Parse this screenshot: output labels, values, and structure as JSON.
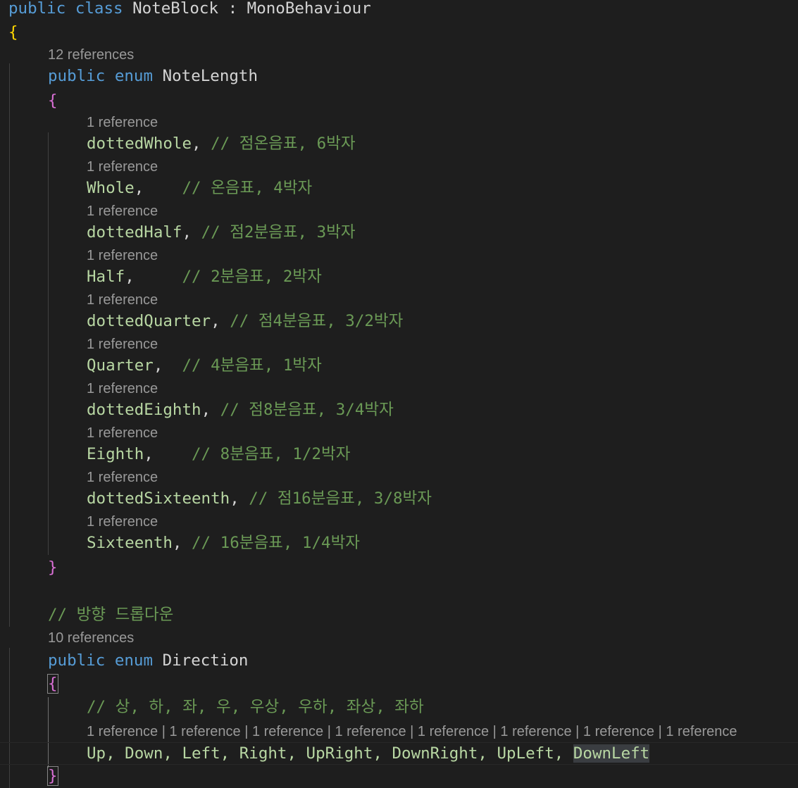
{
  "code": {
    "class_decl": {
      "kw_public": "public",
      "kw_class": "class",
      "class_name": "NoteBlock",
      "colon": ":",
      "base": "MonoBehaviour"
    },
    "open_brace": "{",
    "close_brace": "}",
    "lens_12": "12 references",
    "lens_10": "10 references",
    "lens_1": "1 reference",
    "lens_8x": "1 reference | 1 reference | 1 reference | 1 reference | 1 reference | 1 reference | 1 reference | 1 reference",
    "enum1": {
      "kw_public": "public",
      "kw_enum": "enum",
      "name": "NoteLength",
      "members": [
        {
          "name": "dottedWhole",
          "sep": ",",
          "pad": " ",
          "comment": "// 점온음표, 6박자"
        },
        {
          "name": "Whole",
          "sep": ",",
          "pad": "    ",
          "comment": "// 온음표, 4박자"
        },
        {
          "name": "dottedHalf",
          "sep": ",",
          "pad": " ",
          "comment": "// 점2분음표, 3박자"
        },
        {
          "name": "Half",
          "sep": ",",
          "pad": "     ",
          "comment": "// 2분음표, 2박자"
        },
        {
          "name": "dottedQuarter",
          "sep": ",",
          "pad": " ",
          "comment": "// 점4분음표, 3/2박자"
        },
        {
          "name": "Quarter",
          "sep": ",",
          "pad": "  ",
          "comment": "// 4분음표, 1박자"
        },
        {
          "name": "dottedEighth",
          "sep": ",",
          "pad": " ",
          "comment": "// 점8분음표, 3/4박자"
        },
        {
          "name": "Eighth",
          "sep": ",",
          "pad": "    ",
          "comment": "// 8분음표, 1/2박자"
        },
        {
          "name": "dottedSixteenth",
          "sep": ",",
          "pad": " ",
          "comment": "// 점16분음표, 3/8박자"
        },
        {
          "name": "Sixteenth",
          "sep": ",",
          "pad": " ",
          "comment": "// 16분음표, 1/4박자"
        }
      ]
    },
    "direction_comment": "// 방향 드롭다운",
    "enum2": {
      "kw_public": "public",
      "kw_enum": "enum",
      "name": "Direction",
      "inner_comment": "// 상, 하, 좌, 우, 우상, 우하, 좌상, 좌하",
      "members_pre": "Up, Down, Left, Right, UpRight, DownRight, UpLeft, ",
      "members_last": "DownLeft"
    }
  },
  "colors": {
    "background": "#1e1e1e",
    "keyword": "#569cd6",
    "type": "#4ec9b0",
    "enum_member": "#b8d7a3",
    "comment": "#6a9955",
    "codelens": "#999999",
    "brace_level1": "#ffd700",
    "brace_level2": "#da70d6"
  }
}
